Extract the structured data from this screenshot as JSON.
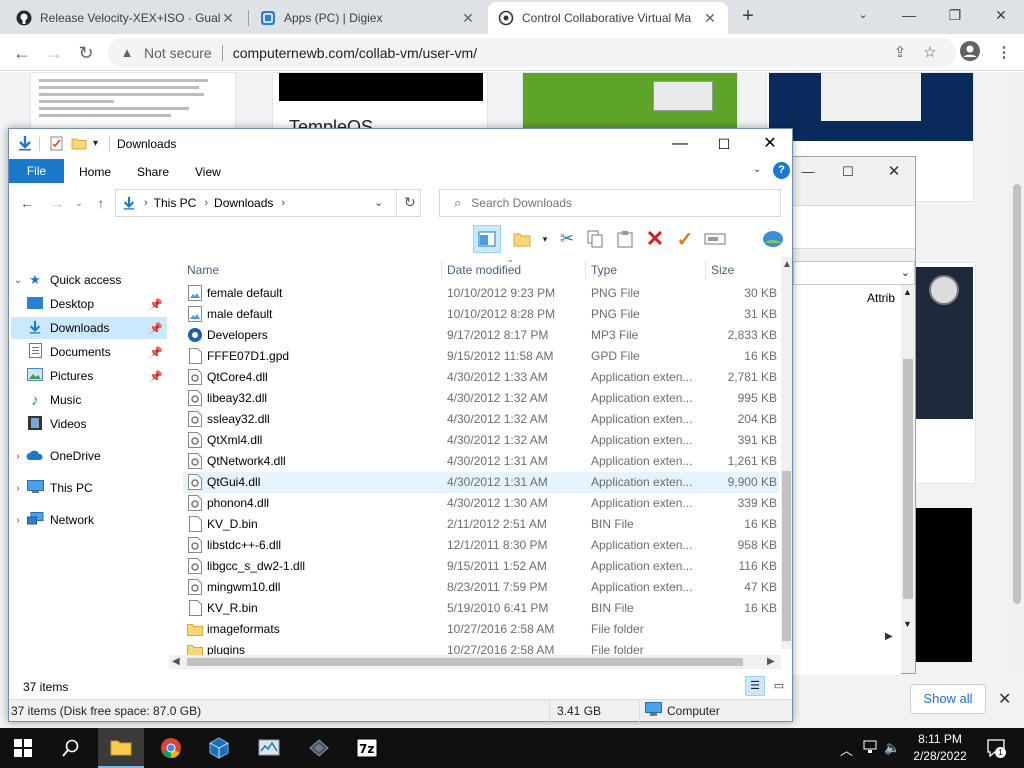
{
  "browser": {
    "tabs": [
      {
        "title": "Release Velocity-XEX+ISO · Gualc",
        "active": false
      },
      {
        "title": "Apps (PC) | Digiex",
        "active": false
      },
      {
        "title": "Control Collaborative Virtual Ma",
        "active": true
      }
    ],
    "new_tab": "+",
    "security_label": "Not secure",
    "url": "computernewb.com/collab-vm/user-vm/"
  },
  "webpage": {
    "card_title": "TempleOS",
    "show_all": "Show all"
  },
  "explorer": {
    "title": "Downloads",
    "ribbon_tabs": [
      "File",
      "Home",
      "Share",
      "View"
    ],
    "breadcrumb": [
      "This PC",
      "Downloads"
    ],
    "search_placeholder": "Search Downloads",
    "nav": {
      "quick_access": "Quick access",
      "pinned": [
        "Desktop",
        "Downloads",
        "Documents",
        "Pictures"
      ],
      "unpinned": [
        "Music",
        "Videos"
      ],
      "onedrive": "OneDrive",
      "this_pc": "This PC",
      "network": "Network"
    },
    "columns": [
      "Name",
      "Date modified",
      "Type",
      "Size"
    ],
    "files": [
      {
        "name": "female default",
        "date": "10/10/2012 9:23 PM",
        "type": "PNG File",
        "size": "30 KB",
        "icon": "image-file-icon"
      },
      {
        "name": "male default",
        "date": "10/10/2012 8:28 PM",
        "type": "PNG File",
        "size": "31 KB",
        "icon": "image-file-icon"
      },
      {
        "name": "Developers",
        "date": "9/17/2012 8:17 PM",
        "type": "MP3 File",
        "size": "2,833 KB",
        "icon": "audio-file-icon"
      },
      {
        "name": "FFFE07D1.gpd",
        "date": "9/15/2012 11:58 AM",
        "type": "GPD File",
        "size": "16 KB",
        "icon": "generic-file-icon"
      },
      {
        "name": "QtCore4.dll",
        "date": "4/30/2012 1:33 AM",
        "type": "Application exten...",
        "size": "2,781 KB",
        "icon": "dll-file-icon"
      },
      {
        "name": "libeay32.dll",
        "date": "4/30/2012 1:32 AM",
        "type": "Application exten...",
        "size": "995 KB",
        "icon": "dll-file-icon"
      },
      {
        "name": "ssleay32.dll",
        "date": "4/30/2012 1:32 AM",
        "type": "Application exten...",
        "size": "204 KB",
        "icon": "dll-file-icon"
      },
      {
        "name": "QtXml4.dll",
        "date": "4/30/2012 1:32 AM",
        "type": "Application exten...",
        "size": "391 KB",
        "icon": "dll-file-icon"
      },
      {
        "name": "QtNetwork4.dll",
        "date": "4/30/2012 1:31 AM",
        "type": "Application exten...",
        "size": "1,261 KB",
        "icon": "dll-file-icon"
      },
      {
        "name": "QtGui4.dll",
        "date": "4/30/2012 1:31 AM",
        "type": "Application exten...",
        "size": "9,900 KB",
        "icon": "dll-file-icon"
      },
      {
        "name": "phonon4.dll",
        "date": "4/30/2012 1:30 AM",
        "type": "Application exten...",
        "size": "339 KB",
        "icon": "dll-file-icon"
      },
      {
        "name": "KV_D.bin",
        "date": "2/11/2012 2:51 AM",
        "type": "BIN File",
        "size": "16 KB",
        "icon": "generic-file-icon"
      },
      {
        "name": "libstdc++-6.dll",
        "date": "12/1/2011 8:30 PM",
        "type": "Application exten...",
        "size": "958 KB",
        "icon": "dll-file-icon"
      },
      {
        "name": "libgcc_s_dw2-1.dll",
        "date": "9/15/2011 1:52 AM",
        "type": "Application exten...",
        "size": "116 KB",
        "icon": "dll-file-icon"
      },
      {
        "name": "mingwm10.dll",
        "date": "8/23/2011 7:59 PM",
        "type": "Application exten...",
        "size": "47 KB",
        "icon": "dll-file-icon"
      },
      {
        "name": "KV_R.bin",
        "date": "5/19/2010 6:41 PM",
        "type": "BIN File",
        "size": "16 KB",
        "icon": "generic-file-icon"
      },
      {
        "name": "imageformats",
        "date": "10/27/2016 2:58 AM",
        "type": "File folder",
        "size": "",
        "icon": "folder-icon"
      },
      {
        "name": "plugins",
        "date": "10/27/2016 2:58 AM",
        "type": "File folder",
        "size": "",
        "icon": "folder-icon"
      }
    ],
    "item_count": "37 items",
    "status": {
      "disk": "37 items (Disk free space: 87.0 GB)",
      "size": "3.41 GB",
      "location": "Computer"
    }
  },
  "second_window": {
    "column": "Attrib"
  },
  "taskbar": {
    "time": "8:11 PM",
    "date": "2/28/2022",
    "notification_count": "1"
  },
  "colors": {
    "accent": "#1979ca",
    "selection": "#cce8ff",
    "taskbar": "#101010"
  }
}
